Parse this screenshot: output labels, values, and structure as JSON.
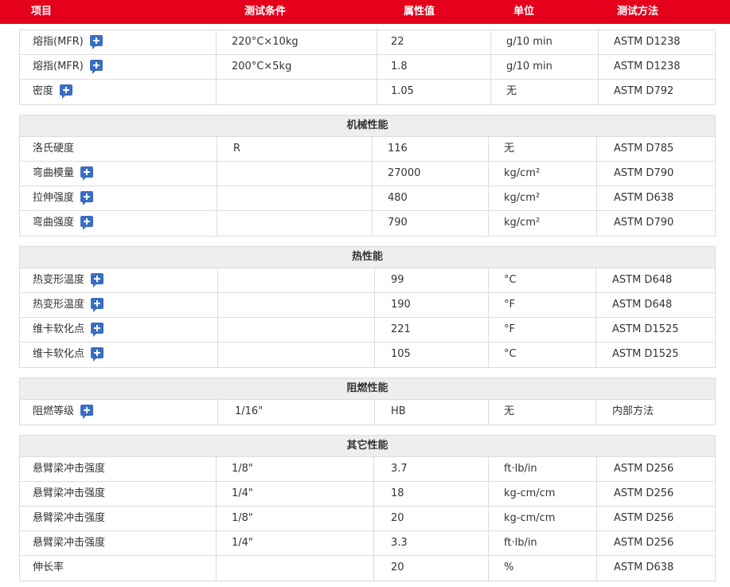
{
  "header": [
    "项目",
    "测试条件",
    "属性值",
    "单位",
    "测试方法"
  ],
  "sections": [
    {
      "title": "",
      "rows": [
        {
          "item": "熔指(MFR)",
          "plus": true,
          "cond": "220°C×10kg",
          "value": "22",
          "unit": "g/10 min",
          "method": "ASTM D1238"
        },
        {
          "item": "熔指(MFR)",
          "plus": true,
          "cond": "200°C×5kg",
          "value": "1.8",
          "unit": "g/10 min",
          "method": "ASTM D1238"
        },
        {
          "item": "密度",
          "plus": true,
          "cond": "",
          "value": "1.05",
          "unit": "无",
          "method": "ASTM D792"
        }
      ]
    },
    {
      "title": "机械性能",
      "rows": [
        {
          "item": "洛氏硬度",
          "plus": false,
          "cond": "R",
          "value": "116",
          "unit": "无",
          "method": "ASTM D785"
        },
        {
          "item": "弯曲模量",
          "plus": true,
          "cond": "",
          "value": "27000",
          "unit": "kg/cm²",
          "method": "ASTM D790"
        },
        {
          "item": "拉伸强度",
          "plus": true,
          "cond": "",
          "value": "480",
          "unit": "kg/cm²",
          "method": "ASTM D638"
        },
        {
          "item": "弯曲强度",
          "plus": true,
          "cond": "",
          "value": "790",
          "unit": "kg/cm²",
          "method": "ASTM D790"
        }
      ]
    },
    {
      "title": "热性能",
      "rows": [
        {
          "item": "热变形温度",
          "plus": true,
          "cond": "",
          "value": "99",
          "unit": "°C",
          "method": "ASTM D648"
        },
        {
          "item": "热变形温度",
          "plus": true,
          "cond": "",
          "value": "190",
          "unit": "°F",
          "method": "ASTM D648"
        },
        {
          "item": "维卡软化点",
          "plus": true,
          "cond": "",
          "value": "221",
          "unit": "°F",
          "method": "ASTM D1525"
        },
        {
          "item": "维卡软化点",
          "plus": true,
          "cond": "",
          "value": "105",
          "unit": "°C",
          "method": "ASTM D1525"
        }
      ]
    },
    {
      "title": "阻燃性能",
      "rows": [
        {
          "item": "阻燃等级",
          "plus": true,
          "cond": "1/16\"",
          "value": "HB",
          "unit": "无",
          "method": "内部方法"
        }
      ]
    },
    {
      "title": "其它性能",
      "rows": [
        {
          "item": "悬臂梁冲击强度",
          "plus": false,
          "cond": "1/8\"",
          "value": "3.7",
          "unit": "ft·lb/in",
          "method": "ASTM D256"
        },
        {
          "item": "悬臂梁冲击强度",
          "plus": false,
          "cond": "1/4\"",
          "value": "18",
          "unit": "kg-cm/cm",
          "method": "ASTM D256"
        },
        {
          "item": "悬臂梁冲击强度",
          "plus": false,
          "cond": "1/8\"",
          "value": "20",
          "unit": "kg-cm/cm",
          "method": "ASTM D256"
        },
        {
          "item": "悬臂梁冲击强度",
          "plus": false,
          "cond": "1/4\"",
          "value": "3.3",
          "unit": "ft·lb/in",
          "method": "ASTM D256"
        },
        {
          "item": "伸长率",
          "plus": false,
          "cond": "",
          "value": "20",
          "unit": "%",
          "method": "ASTM D638"
        }
      ]
    }
  ],
  "icons": {
    "expand": "plus-square-icon"
  },
  "colors": {
    "header_bg": "#e5001c",
    "section_title_bg": "#eeeeee",
    "icon_bg": "#3a6ec2",
    "border": "#dcdcdc"
  }
}
